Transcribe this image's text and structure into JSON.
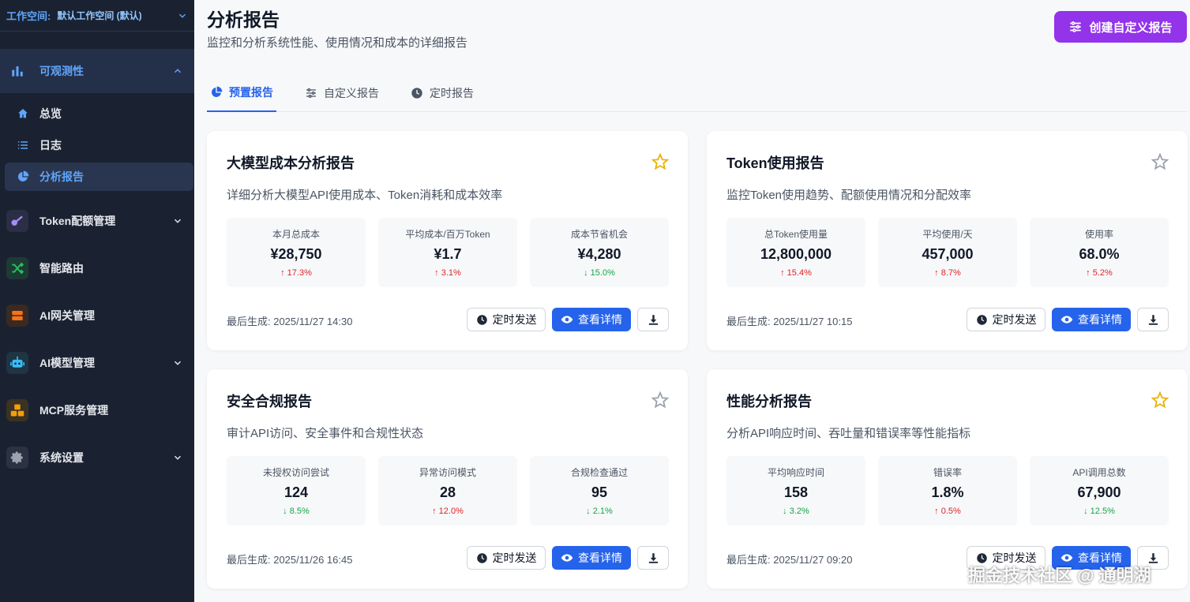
{
  "workspace": {
    "label": "工作空间:",
    "name": "默认工作空间 (默认)"
  },
  "nav": {
    "observability": "可观测性",
    "sub": {
      "overview": "总览",
      "logs": "日志",
      "reports": "分析报告"
    },
    "token_quota": "Token配额管理",
    "smart_routing": "智能路由",
    "ai_gateway": "AI网关管理",
    "ai_model": "AI模型管理",
    "mcp": "MCP服务管理",
    "settings": "系统设置"
  },
  "page": {
    "title": "分析报告",
    "subtitle": "监控和分析系统性能、使用情况和成本的详细报告",
    "create_button": "创建自定义报告"
  },
  "tabs": [
    "预置报告",
    "自定义报告",
    "定时报告"
  ],
  "buttons": {
    "schedule": "定时发送",
    "detail": "查看详情"
  },
  "cards": [
    {
      "title": "大模型成本分析报告",
      "starred": true,
      "desc": "详细分析大模型API使用成本、Token消耗和成本效率",
      "metrics": [
        {
          "label": "本月总成本",
          "value": "¥28,750",
          "change": "↑ 17.3%",
          "dir": "up"
        },
        {
          "label": "平均成本/百万Token",
          "value": "¥1.7",
          "change": "↑ 3.1%",
          "dir": "up"
        },
        {
          "label": "成本节省机会",
          "value": "¥4,280",
          "change": "↓ 15.0%",
          "dir": "down"
        }
      ],
      "generated": "最后生成: 2025/11/27 14:30"
    },
    {
      "title": "Token使用报告",
      "starred": false,
      "desc": "监控Token使用趋势、配额使用情况和分配效率",
      "metrics": [
        {
          "label": "总Token使用量",
          "value": "12,800,000",
          "change": "↑ 15.4%",
          "dir": "up"
        },
        {
          "label": "平均使用/天",
          "value": "457,000",
          "change": "↑ 8.7%",
          "dir": "up"
        },
        {
          "label": "使用率",
          "value": "68.0%",
          "change": "↑ 5.2%",
          "dir": "up"
        }
      ],
      "generated": "最后生成: 2025/11/27 10:15"
    },
    {
      "title": "安全合规报告",
      "starred": false,
      "desc": "审计API访问、安全事件和合规性状态",
      "metrics": [
        {
          "label": "未授权访问尝试",
          "value": "124",
          "change": "↓ 8.5%",
          "dir": "down"
        },
        {
          "label": "异常访问模式",
          "value": "28",
          "change": "↑ 12.0%",
          "dir": "up"
        },
        {
          "label": "合规检查通过",
          "value": "95",
          "change": "↓ 2.1%",
          "dir": "down"
        }
      ],
      "generated": "最后生成: 2025/11/26 16:45"
    },
    {
      "title": "性能分析报告",
      "starred": true,
      "desc": "分析API响应时间、吞吐量和错误率等性能指标",
      "metrics": [
        {
          "label": "平均响应时间",
          "value": "158",
          "change": "↓ 3.2%",
          "dir": "down"
        },
        {
          "label": "错误率",
          "value": "1.8%",
          "change": "↑ 0.5%",
          "dir": "up"
        },
        {
          "label": "API调用总数",
          "value": "67,900",
          "change": "↓ 12.5%",
          "dir": "down"
        }
      ],
      "generated": "最后生成: 2025/11/27 09:20"
    }
  ],
  "watermark": "掘金技术社区 @ 通明湖",
  "colors": {
    "accent": "#2563eb",
    "purple": "#9333ea",
    "sidebar": "#1a2232",
    "up": "#dc2626",
    "down": "#16a34a"
  }
}
